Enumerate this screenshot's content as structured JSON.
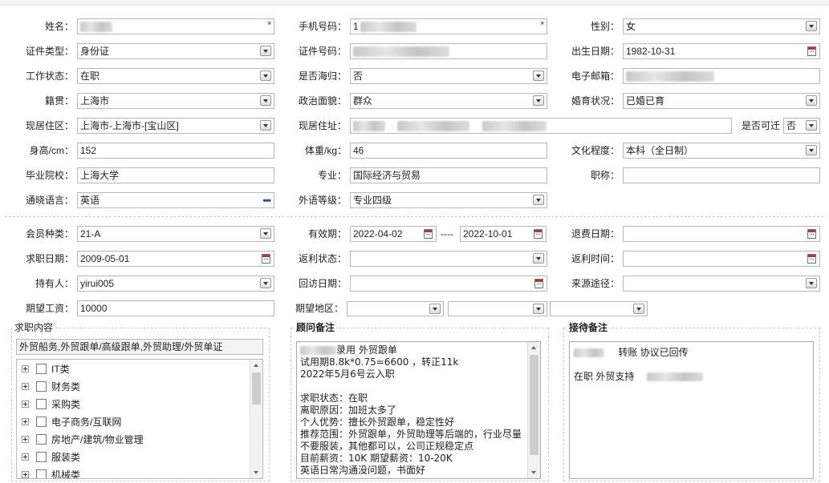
{
  "row1": {
    "name_label": "姓名：",
    "phone_label": "手机号码：",
    "phone_prefix": "1",
    "gender_label": "性别：",
    "gender_value": "女"
  },
  "row2": {
    "idtype_label": "证件类型：",
    "idtype_value": "身份证",
    "idno_label": "证件号码：",
    "birth_label": "出生日期：",
    "birth_value": "1982-10-31"
  },
  "row3": {
    "work_label": "工作状态：",
    "work_value": "在职",
    "overseas_label": "是否海归：",
    "overseas_value": "否",
    "email_label": "电子邮箱："
  },
  "row4": {
    "native_label": "籍贯：",
    "native_value": "上海市",
    "political_label": "政治面貌：",
    "political_value": "群众",
    "marital_label": "婚育状况：",
    "marital_value": "已婚已育"
  },
  "row5": {
    "region_label": "现居住区：",
    "region_value": "上海市-上海市-[宝山区]",
    "address_label": "现居住址：",
    "relocate_label": "是否可迁",
    "relocate_value": "否"
  },
  "row6": {
    "height_label": "身高/cm：",
    "height_value": "152",
    "weight_label": "体重/kg：",
    "weight_value": "46",
    "edu_label": "文化程度：",
    "edu_value": "本科（全日制）"
  },
  "row7": {
    "school_label": "毕业院校：",
    "school_value": "上海大学",
    "major_label": "专业：",
    "major_value": "国际经济与贸易",
    "title_label": "职称："
  },
  "row8": {
    "lang_label": "通晓语言：",
    "lang_value": "英语",
    "lang_more": "•••",
    "level_label": "外语等级：",
    "level_value": "专业四级"
  },
  "row9": {
    "member_label": "会员种类：",
    "member_value": "21-A",
    "valid_label": "有效期：",
    "valid_from": "2022-04-02",
    "valid_sep": "----",
    "valid_to": "2022-10-01",
    "refund_label": "退费日期："
  },
  "row10": {
    "apply_label": "求职日期：",
    "apply_value": "2009-05-01",
    "rebate_status_label": "返利状态：",
    "rebate_time_label": "返利时间："
  },
  "row11": {
    "holder_label": "持有人：",
    "holder_value": "yirui005",
    "visit_label": "回访日期：",
    "source_label": "来源途径："
  },
  "row12": {
    "salary_label": "期望工资：",
    "salary_value": "10000",
    "area_label": "期望地区："
  },
  "job": {
    "title": "求职内容",
    "selected": "外贸船务,外贸跟单/高级跟单,外贸助理/外贸单证",
    "categories": [
      "IT类",
      "财务类",
      "采购类",
      "电子商务/互联网",
      "房地产/建筑/物业管理",
      "服装类",
      "机械类"
    ]
  },
  "consultant": {
    "title": "顾问备注",
    "lines": [
      "录用  外贸跟单",
      "试用期8.8k*0.75=6600 ，转正11k",
      "2022年5月6号云入职",
      "",
      "求职状态：在职",
      "离职原因：加班太多了",
      "个人优势：擅长外贸跟单，稳定性好",
      "推荐范围：外贸跟单，外贸助理等后端的，行业尽量",
      "不要服装，其他都可以，公司正规稳定点",
      "目前薪资：10K  期望薪资：10-20K",
      "英语日常沟通没问题，书面好"
    ]
  },
  "reception": {
    "title": "接待备注",
    "line1": "转账  协议已回传",
    "line2": "在职  外贸支持"
  }
}
